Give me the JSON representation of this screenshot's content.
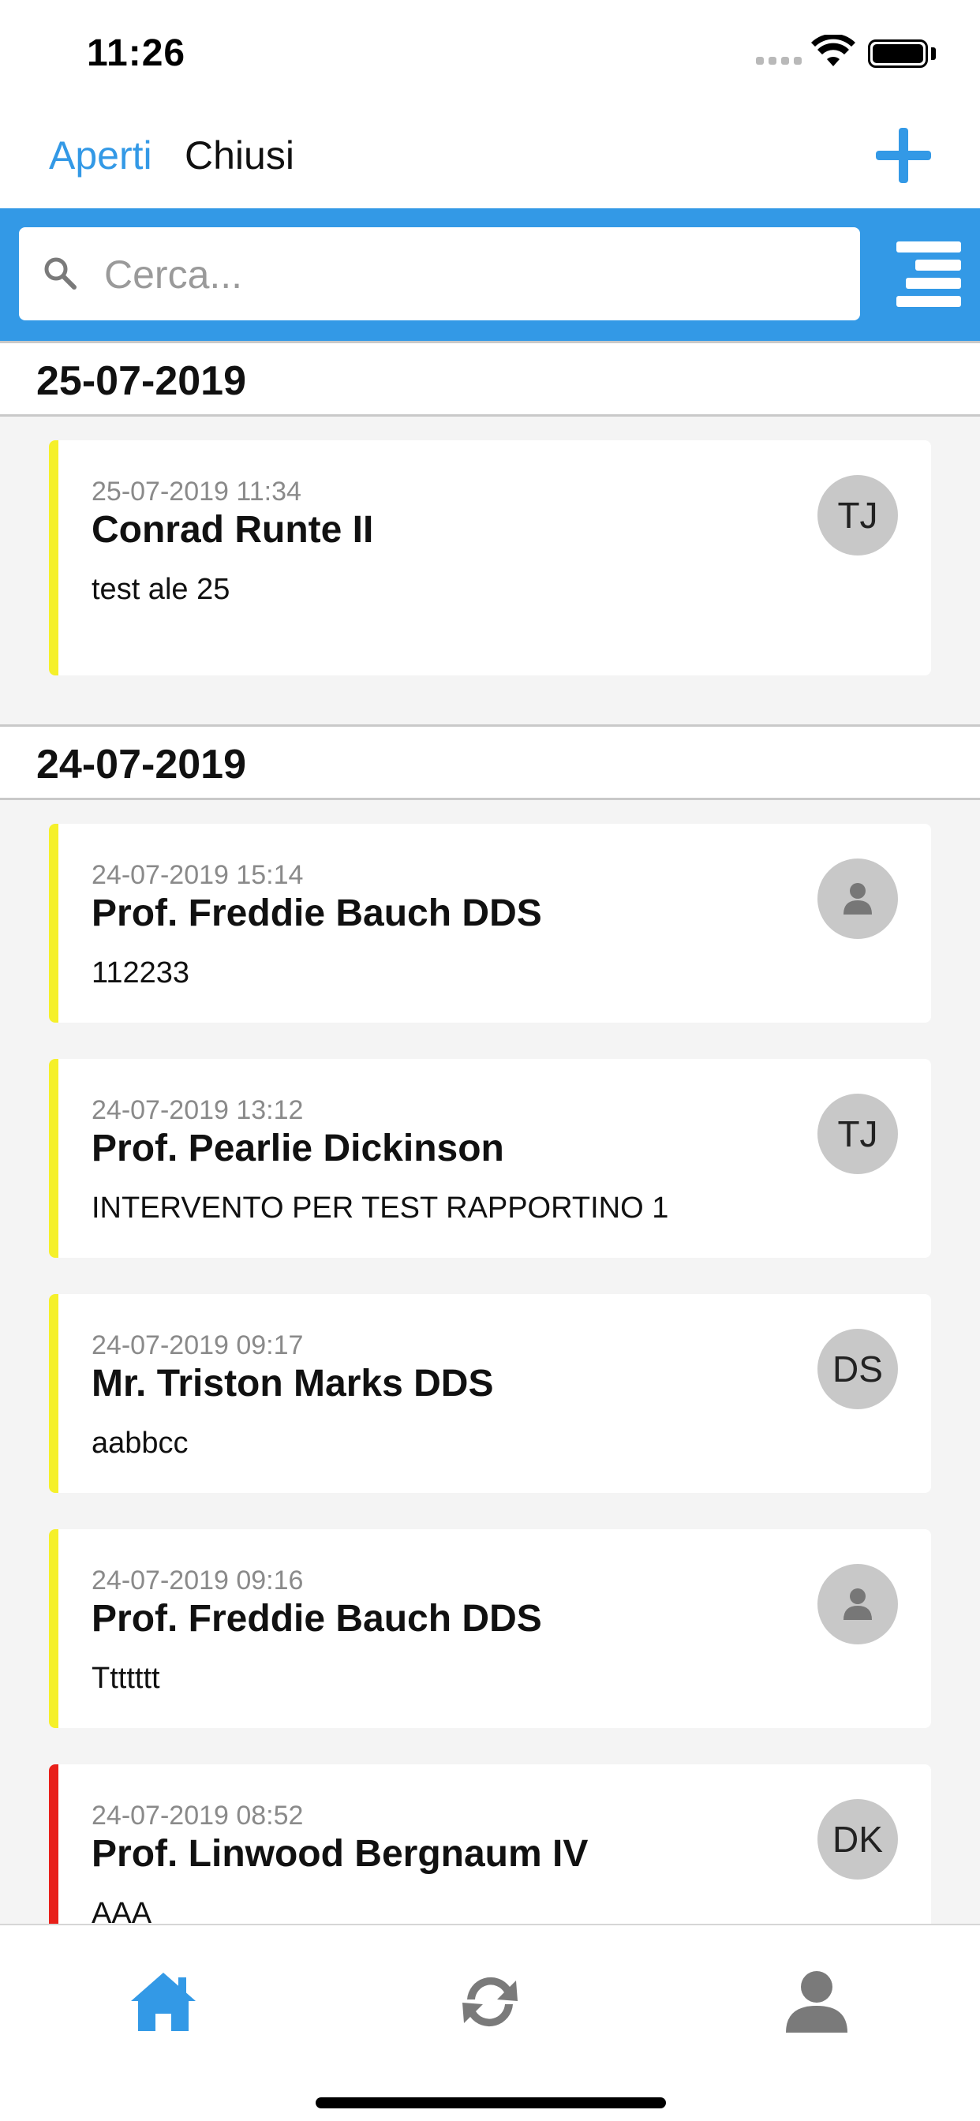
{
  "status_bar": {
    "time": "11:26",
    "icons": [
      "signal-icon",
      "wifi-icon",
      "battery-icon"
    ]
  },
  "header": {
    "tabs": [
      {
        "label": "Aperti",
        "active": true
      },
      {
        "label": "Chiusi",
        "active": false
      }
    ],
    "add_icon": "plus-icon"
  },
  "search": {
    "placeholder": "Cerca...",
    "value": "",
    "icon": "search-icon",
    "filter_icon": "filter-icon"
  },
  "colors": {
    "accent": "#3399e6",
    "status_yellow": "#f5f02a",
    "status_red": "#e8201a",
    "avatar_bg": "#c8c8c8"
  },
  "sections": [
    {
      "date": "25-07-2019",
      "items": [
        {
          "datetime": "25-07-2019 11:34",
          "title": "Conrad Runte II",
          "description": "test ale 25",
          "avatar": "TJ",
          "status": "yellow"
        }
      ]
    },
    {
      "date": "24-07-2019",
      "items": [
        {
          "datetime": "24-07-2019 15:14",
          "title": "Prof. Freddie Bauch DDS",
          "description": "112233",
          "avatar": "",
          "status": "yellow"
        },
        {
          "datetime": "24-07-2019 13:12",
          "title": "Prof. Pearlie Dickinson",
          "description": "INTERVENTO PER TEST RAPPORTINO 1",
          "avatar": "TJ",
          "status": "yellow"
        },
        {
          "datetime": "24-07-2019 09:17",
          "title": "Mr. Triston Marks DDS",
          "description": "aabbcc",
          "avatar": "DS",
          "status": "yellow"
        },
        {
          "datetime": "24-07-2019 09:16",
          "title": "Prof. Freddie Bauch DDS",
          "description": "Ttttttt",
          "avatar": "",
          "status": "yellow"
        },
        {
          "datetime": "24-07-2019 08:52",
          "title": "Prof. Linwood Bergnaum IV",
          "description": "AAA",
          "avatar": "DK",
          "status": "red"
        }
      ]
    }
  ],
  "tab_bar": {
    "items": [
      {
        "icon": "home-icon",
        "active": true
      },
      {
        "icon": "sync-icon",
        "active": false
      },
      {
        "icon": "user-icon",
        "active": false
      }
    ]
  }
}
